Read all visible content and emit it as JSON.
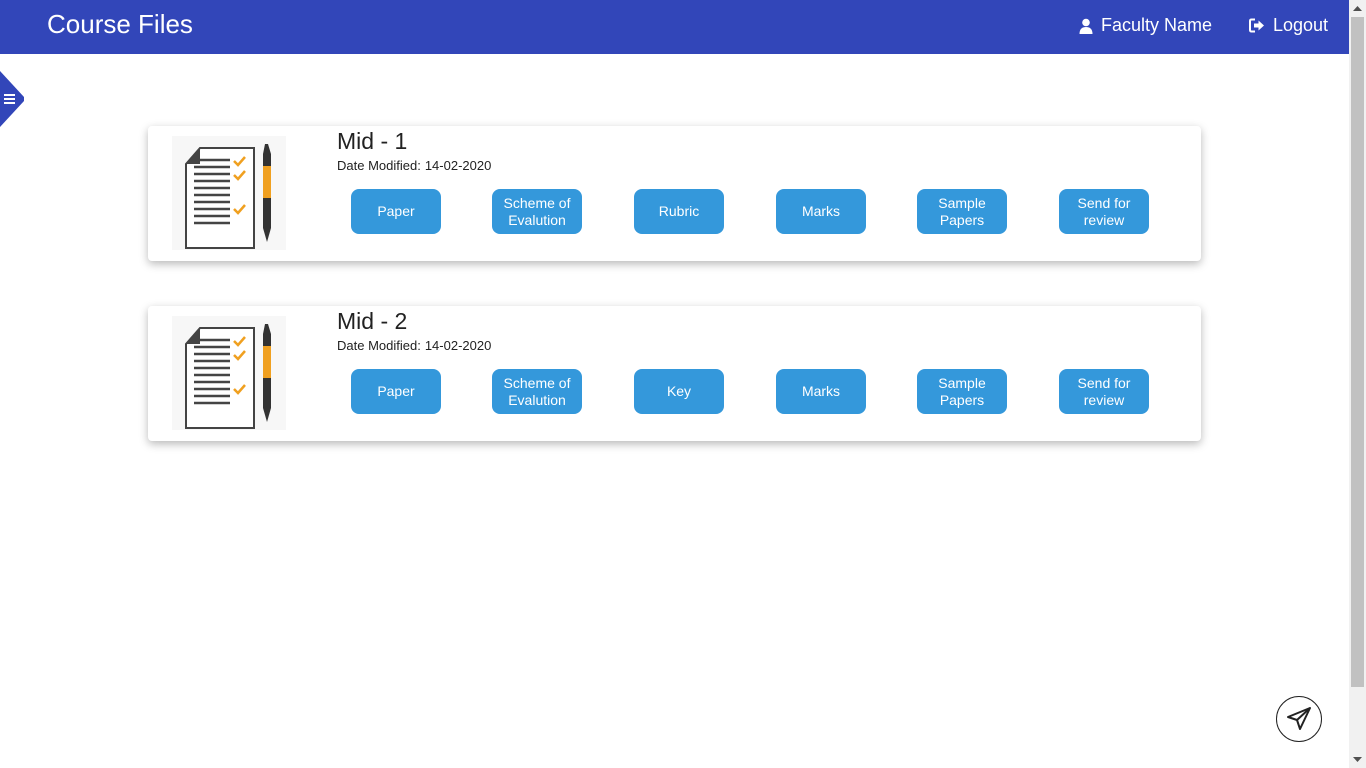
{
  "header": {
    "title": "Course Files",
    "user_label": "Faculty Name",
    "logout_label": "Logout"
  },
  "cards": [
    {
      "title": "Mid - 1",
      "date_label": "Date Modified:",
      "date_value": "14-02-2020",
      "buttons": [
        "Paper",
        "Scheme of Evalution",
        "Rubric",
        "Marks",
        "Sample Papers",
        "Send for review"
      ]
    },
    {
      "title": "Mid - 2",
      "date_label": "Date Modified:",
      "date_value": "14-02-2020",
      "buttons": [
        "Paper",
        "Scheme of Evalution",
        "Key",
        "Marks",
        "Sample Papers",
        "Send for review"
      ]
    }
  ],
  "icons": {
    "user": "user-icon",
    "logout": "logout-icon",
    "menu": "menu-icon",
    "document": "document-checklist-icon",
    "send": "paper-plane-icon"
  },
  "colors": {
    "header_bg": "#3246b9",
    "button_bg": "#3498db",
    "check_accent": "#f0a020"
  }
}
